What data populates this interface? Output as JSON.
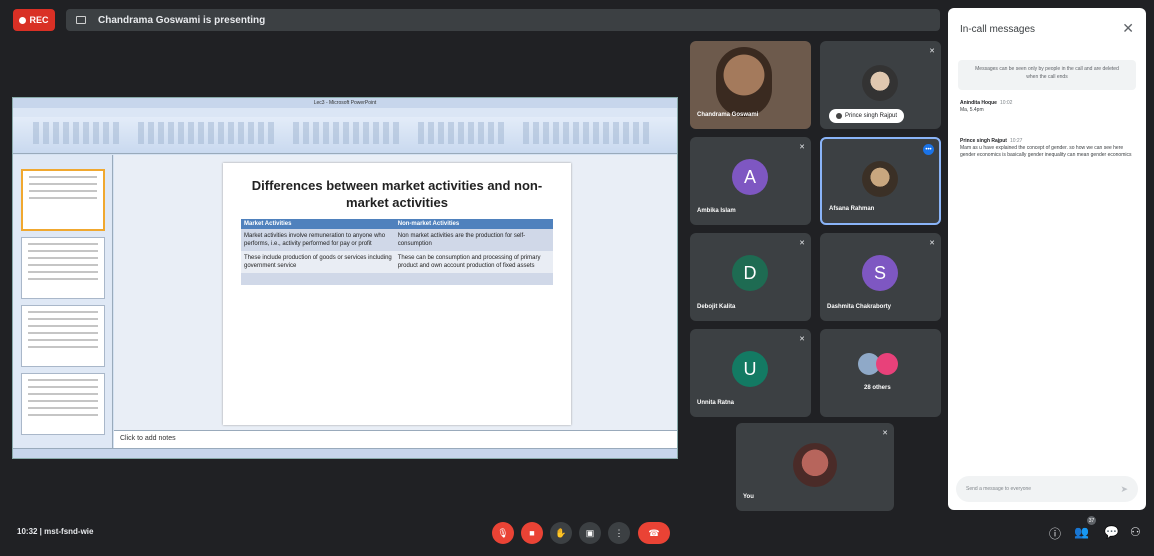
{
  "top_bar": {
    "rec_label": "REC",
    "presenting_text": "Chandrama Goswami is presenting"
  },
  "presentation": {
    "window_title": "Lec3 - Microsoft PowerPoint",
    "slide_title": "Differences between market activities and non-market activities",
    "table": {
      "headers": [
        "Market Activities",
        "Non-market Activities"
      ],
      "rows": [
        [
          "Market activities involve remuneration to anyone who performs, i.e., activity performed for pay or profit",
          "Non market activities are the production for self-consumption"
        ],
        [
          "These include production of goods or services including government service",
          "These can be consumption and processing of primary product and own account production of fixed assets"
        ],
        [
          "",
          ""
        ]
      ]
    },
    "notes_placeholder": "Click to add notes"
  },
  "participants": [
    {
      "name": "Chandrama Goswami",
      "kind": "video"
    },
    {
      "name": "Prince singh Rajput",
      "kind": "photo"
    },
    {
      "name": "Ambika Islam",
      "initial": "A",
      "color": "#7e57c2"
    },
    {
      "name": "Afsana Rahman",
      "kind": "photo"
    },
    {
      "name": "Debojit Kalita",
      "initial": "D",
      "color": "#1e6b52"
    },
    {
      "name": "Dashmita Chakraborty",
      "initial": "S",
      "color": "#7e57c2"
    },
    {
      "name": "Unnita Ratna",
      "initial": "U",
      "color": "#137a63"
    },
    {
      "name": "28 others",
      "kind": "group"
    },
    {
      "name": "You",
      "kind": "self"
    }
  ],
  "chat": {
    "title": "In-call messages",
    "notice": "Messages can be seen only by people in the call and are deleted when the call ends",
    "messages": [
      {
        "sender": "Anindita Hoque",
        "time": "10:02",
        "text": "Ma, 5.4pm"
      },
      {
        "sender": "Prince singh Rajput",
        "time": "10:27",
        "text": "Mam as u have explained the concept of gender. so how we can see here gender economics is basically gender inequality can mean gender economics"
      }
    ],
    "input_placeholder": "Send a message to everyone"
  },
  "bottom_bar": {
    "meeting_info": "10:32 | mst-fsnd-wie",
    "people_count": "37"
  },
  "icons": {
    "mic": "mic-off-icon",
    "camera": "camera-off-icon",
    "hand": "raise-hand-icon",
    "present": "present-icon",
    "more": "more-options-icon",
    "hangup": "hang-up-icon",
    "info": "info-icon",
    "people": "people-icon",
    "chat": "chat-icon",
    "activities": "activities-icon"
  },
  "colors": {
    "rec": "#d93025",
    "end_call": "#ea4335",
    "accent": "#8ab4f8"
  }
}
